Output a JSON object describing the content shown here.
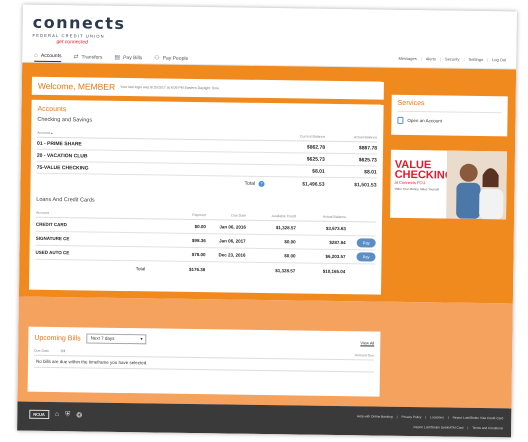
{
  "logo": {
    "name": "connects",
    "subtitle": "FEDERAL CREDIT UNION",
    "tagline": "get connected"
  },
  "nav": {
    "tabs": [
      {
        "label": "Accounts",
        "icon": "home-icon"
      },
      {
        "label": "Transfers",
        "icon": "arrows-icon"
      },
      {
        "label": "Pay Bills",
        "icon": "bills-icon"
      },
      {
        "label": "Pay People",
        "icon": "people-icon"
      }
    ],
    "links": [
      "Messages",
      "Alerts",
      "Security",
      "Settings",
      "Log Out"
    ]
  },
  "welcome": {
    "title": "Welcome, MEMBER",
    "note": "Your last login was 9/15/2017 at 8:09 PM Eastern Daylight Time."
  },
  "accounts": {
    "title": "Accounts",
    "subtitle": "Checking and Savings",
    "headers": {
      "account": "Account",
      "current": "Current Balance",
      "available": "Actual Balance"
    },
    "rows": [
      {
        "name": "01 - PRIME SHARE",
        "current": "$862.78",
        "available": "$867.78"
      },
      {
        "name": "20 - VACATION CLUB",
        "current": "$625.73",
        "available": "$625.73"
      },
      {
        "name": "75-VALUE CHECKING",
        "current": "$8.01",
        "available": "$8.01"
      }
    ],
    "total": {
      "label": "Total",
      "current": "$1,496.53",
      "available": "$1,501.53"
    }
  },
  "loans": {
    "subtitle": "Loans And Credit Cards",
    "headers": {
      "account": "Account",
      "payment": "Payment",
      "due": "Due Date",
      "available": "Available Credit",
      "balance": "Actual Balance"
    },
    "rows": [
      {
        "name": "CREDIT CARD",
        "payment": "$0.00",
        "due": "Jan 06, 2016",
        "available": "$1,328.57",
        "balance": "$3,673.63",
        "pay": ""
      },
      {
        "name": "SIGNATURE CE",
        "payment": "$98.36",
        "due": "Jan 06, 2017",
        "available": "$0.00",
        "balance": "$287.84",
        "pay": "Pay"
      },
      {
        "name": "USED AUTO CE",
        "payment": "$78.00",
        "due": "Dec 23, 2016",
        "available": "$0.00",
        "balance": "$6,203.57",
        "pay": "Pay"
      }
    ],
    "total": {
      "label": "Total",
      "payment": "$176.36",
      "available": "$1,328.57",
      "balance": "$10,165.04"
    }
  },
  "services": {
    "title": "Services",
    "item": "Open an Account"
  },
  "promo": {
    "line1": "VALUE",
    "line2": "CHECKING",
    "line3": "at Connects FCU",
    "line4": "Value Your Money. Value Yourself."
  },
  "bills": {
    "title": "Upcoming Bills",
    "select": "Next 7 days",
    "view_all": "View All",
    "headers": {
      "due": "Due Date",
      "bill": "Bill",
      "amount": "Amount Due"
    },
    "message": "No bills are due within the timeframe you have selected."
  },
  "footer": {
    "ncua": "NCUA",
    "links_row1": [
      "Help with Online Banking",
      "Privacy Policy",
      "Locations",
      "Report Lost/Stolen Visa Credit Card"
    ],
    "links_row2": [
      "Report Lost/Stolen Debit/ATM Card",
      "Terms and Conditions"
    ]
  },
  "colors": {
    "accent": "#f08a1e",
    "accent_light": "#f6a25f",
    "footer": "#3a3a3a",
    "link_red": "#e8192c",
    "pay_button": "#5b8ec4"
  }
}
